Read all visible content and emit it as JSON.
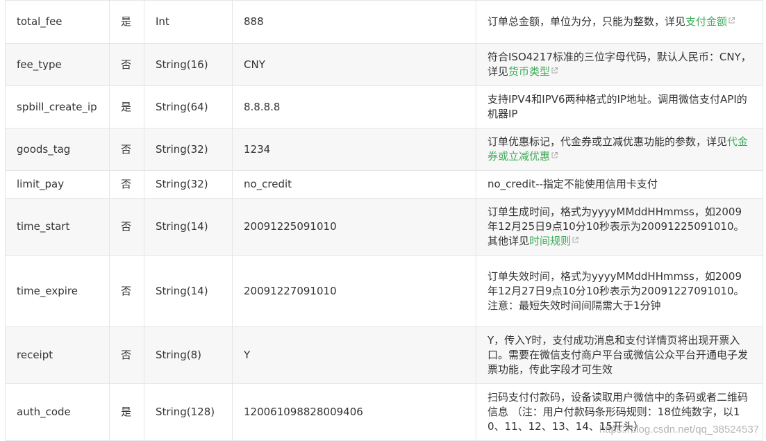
{
  "rows": [
    {
      "name": "total_fee",
      "required": "是",
      "type": "Int",
      "example": "888",
      "desc_text": "订单总金额，单位为分，只能为整数，详见",
      "desc_link": "支付金额",
      "desc_after": ""
    },
    {
      "name": "fee_type",
      "required": "否",
      "type": "String(16)",
      "example": "CNY",
      "desc_text": "符合ISO4217标准的三位字母代码，默认人民币：CNY，详见",
      "desc_link": "货币类型",
      "desc_after": ""
    },
    {
      "name": "spbill_create_ip",
      "required": "是",
      "type": "String(64)",
      "example": "8.8.8.8",
      "desc_text": "支持IPV4和IPV6两种格式的IP地址。调用微信支付API的机器IP",
      "desc_link": "",
      "desc_after": ""
    },
    {
      "name": "goods_tag",
      "required": "否",
      "type": "String(32)",
      "example": "1234",
      "desc_text": "订单优惠标记，代金券或立减优惠功能的参数，详见",
      "desc_link": "代金券或立减优惠",
      "desc_after": ""
    },
    {
      "name": "limit_pay",
      "required": "否",
      "type": "String(32)",
      "example": "no_credit",
      "desc_text": "no_credit--指定不能使用信用卡支付",
      "desc_link": "",
      "desc_after": ""
    },
    {
      "name": "time_start",
      "required": "否",
      "type": "String(14)",
      "example": "20091225091010",
      "desc_text": "订单生成时间，格式为yyyyMMddHHmmss，如2009年12月25日9点10分10秒表示为20091225091010。其他详见",
      "desc_link": "时间规则",
      "desc_after": ""
    },
    {
      "name": "time_expire",
      "required": "否",
      "type": "String(14)",
      "example": "20091227091010",
      "desc_text": "订单失效时间，格式为yyyyMMddHHmmss，如2009年12月27日9点10分10秒表示为20091227091010。注意：最短失效时间间隔需大于1分钟",
      "desc_link": "",
      "desc_after": ""
    },
    {
      "name": "receipt",
      "required": "否",
      "type": "String(8)",
      "example": "Y",
      "desc_text": "Y，传入Y时，支付成功消息和支付详情页将出现开票入口。需要在微信支付商户平台或微信公众平台开通电子发票功能，传此字段才可生效",
      "desc_link": "",
      "desc_after": ""
    },
    {
      "name": "auth_code",
      "required": "是",
      "type": "String(128)",
      "example": "120061098828009406",
      "desc_text": "扫码支付付款码，设备读取用户微信中的条码或者二维码信息 （注：用户付款码条形码规则：18位纯数字，以10、11、12、13、14、15开头）",
      "desc_link": "",
      "desc_after": ""
    }
  ],
  "watermark": "https://blog.csdn.net/qq_38524537",
  "colors": {
    "link": "#3bab57",
    "border": "#e5e5e5",
    "stripe": "#f7f7f7",
    "text": "#333333"
  },
  "icons": {
    "external_link": "external-link-icon"
  }
}
